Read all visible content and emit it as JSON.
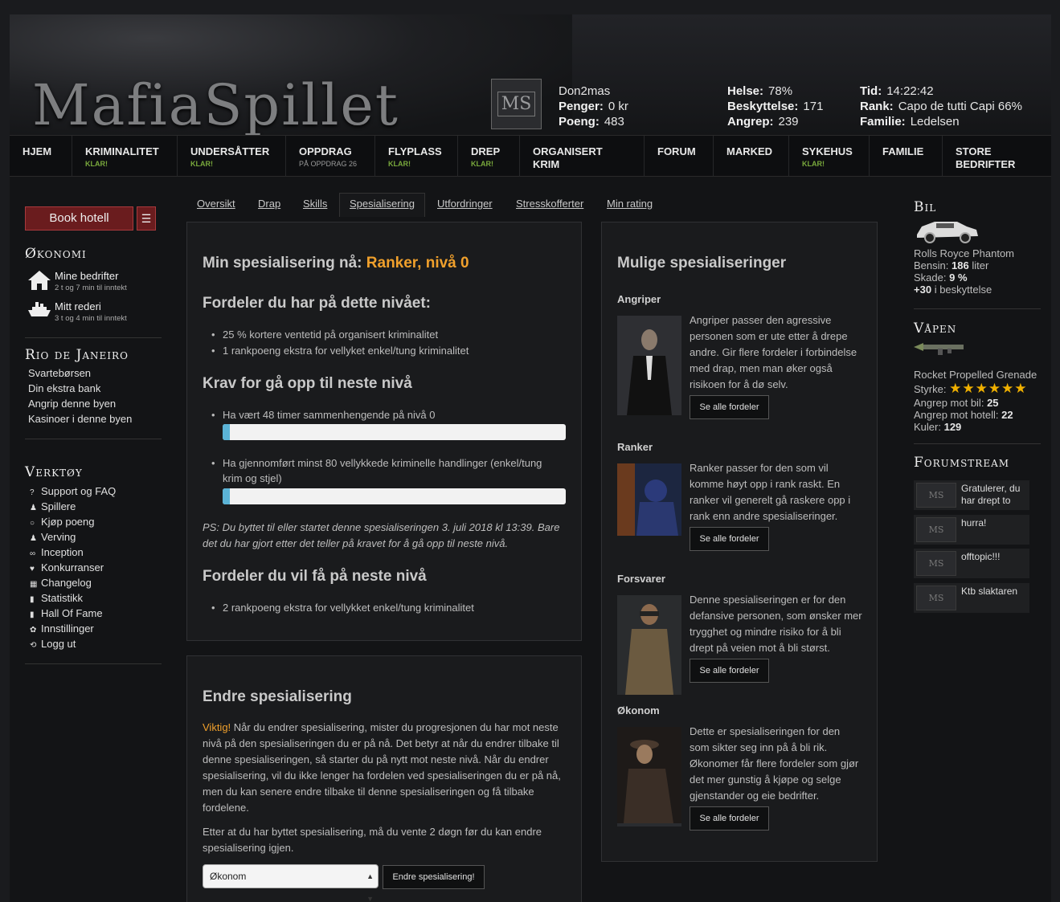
{
  "header": {
    "logo": "MafiaSpillet",
    "avatar": "MS",
    "username": "Don2mas",
    "penger_label": "Penger:",
    "penger": "0 kr",
    "poeng_label": "Poeng:",
    "poeng": "483",
    "helse_label": "Helse:",
    "helse": "78%",
    "beskyttelse_label": "Beskyttelse:",
    "beskyttelse": "171",
    "angrep_label": "Angrep:",
    "angrep": "239",
    "tid_label": "Tid:",
    "tid": "14:22:42",
    "rank_label": "Rank:",
    "rank": "Capo de tutti Capi 66%",
    "familie_label": "Familie:",
    "familie": "Ledelsen"
  },
  "nav": [
    {
      "label": "HJEM",
      "sub": ""
    },
    {
      "label": "KRIMINALITET",
      "sub": "KLAR!"
    },
    {
      "label": "UNDERSÅTTER",
      "sub": "KLAR!"
    },
    {
      "label": "OPPDRAG",
      "sub": "PÅ OPPDRAG 26"
    },
    {
      "label": "FLYPLASS",
      "sub": "KLAR!"
    },
    {
      "label": "DREP",
      "sub": "KLAR!"
    },
    {
      "label": "ORGANISERT KRIM",
      "sub": ""
    },
    {
      "label": "FORUM",
      "sub": ""
    },
    {
      "label": "MARKED",
      "sub": ""
    },
    {
      "label": "SYKEHUS",
      "sub": "KLAR!"
    },
    {
      "label": "FAMILIE",
      "sub": ""
    },
    {
      "label": "STORE BEDRIFTER",
      "sub": ""
    }
  ],
  "sidebar": {
    "book_hotell": "Book hotell",
    "menu_icon": "☰",
    "okonomi_title": "Økonomi",
    "eco_items": [
      {
        "title": "Mine bedrifter",
        "sub": "2 t og 7 min til inntekt",
        "icon": "house-icon"
      },
      {
        "title": "Mitt rederi",
        "sub": "3 t og 4 min til inntekt",
        "icon": "ship-icon"
      }
    ],
    "city_title": "Rio de Janeiro",
    "city_links": [
      "Svartebørsen",
      "Din ekstra bank",
      "Angrip denne byen",
      "Kasinoer i denne byen"
    ],
    "tools_title": "Verktøy",
    "tools": [
      {
        "label": "Support og FAQ",
        "icon": "?"
      },
      {
        "label": "Spillere",
        "icon": "♟"
      },
      {
        "label": "Kjøp poeng",
        "icon": "○"
      },
      {
        "label": "Verving",
        "icon": "♟"
      },
      {
        "label": "Inception",
        "icon": "∞"
      },
      {
        "label": "Konkurranser",
        "icon": "♥"
      },
      {
        "label": "Changelog",
        "icon": "▦"
      },
      {
        "label": "Statistikk",
        "icon": "▮"
      },
      {
        "label": "Hall Of Fame",
        "icon": "▮"
      },
      {
        "label": "Innstillinger",
        "icon": "✿"
      },
      {
        "label": "Logg ut",
        "icon": "⟲"
      }
    ]
  },
  "tabs": [
    "Oversikt",
    "Drap",
    "Skills",
    "Spesialisering",
    "Utfordringer",
    "Stresskofferter",
    "Min rating"
  ],
  "main": {
    "current_prefix": "Min spesialisering nå:",
    "current_value": "Ranker, nivå 0",
    "benefits_title": "Fordeler du har på dette nivået:",
    "benefits": [
      "25 % kortere ventetid på organisert kriminalitet",
      "1 rankpoeng ekstra for vellyket enkel/tung kriminalitet"
    ],
    "req_title": "Krav for gå opp til neste nivå",
    "req1": "Ha vært 48 timer sammenhengende på nivå 0",
    "req1_progress": 0.02,
    "req2_line1": "Ha gjennomført minst 80 vellykkede kriminelle handlinger (enkel/tung",
    "req2_line2": "krim og stjel)",
    "req2_progress": 0.02,
    "ps": "PS: Du byttet til eller startet denne spesialiseringen 3. juli 2018 kl 13:39. Bare det du har gjort etter det teller på kravet for å gå opp til neste nivå.",
    "next_title": "Fordeler du vil få på neste nivå",
    "next_benefits": [
      "2 rankpoeng ekstra for vellykket enkel/tung kriminalitet"
    ]
  },
  "change": {
    "title": "Endre spesialisering",
    "viktig": "Viktig!",
    "text1": " Når du endrer spesialisering, mister du progresjonen du har mot neste nivå på den spesialiseringen du er på nå. Det betyr at når du endrer tilbake til denne spesialiseringen, så starter du på nytt mot neste nivå. Når du endrer spesialisering, vil du ikke lenger ha fordelen ved spesialiseringen du er på nå, men du kan senere endre tilbake til denne spesialiseringen og få tilbake fordelene.",
    "text2": "Etter at du har byttet spesialisering, må du vente 2 døgn før du kan endre spesialisering igjen.",
    "selected": "Økonom",
    "button": "Endre spesialisering!"
  },
  "specs": {
    "title": "Mulige spesialiseringer",
    "button": "Se alle fordeler",
    "items": [
      {
        "name": "Angriper",
        "text": "Angriper passer den agressive personen som er ute etter å drepe andre. Gir flere fordeler i forbindelse med drap, men man øker også risikoen for å dø selv.",
        "color": "#3a3a3e"
      },
      {
        "name": "Ranker",
        "text": "Ranker passer for den som vil komme høyt opp i rank raskt. En ranker vil generelt gå raskere opp i rank enn andre spesialiseringer.",
        "color": "#2b3a6a"
      },
      {
        "name": "Forsvarer",
        "text": "Denne spesialiseringen er for den defansive personen, som ønsker mer trygghet og mindre risiko for å bli drept på veien mot å bli størst.",
        "color": "#5a4a34"
      },
      {
        "name": "Økonom",
        "text": "Dette er spesialiseringen for den som sikter seg inn på å bli rik. Økonomer får flere fordeler som gjør det mer gunstig å kjøpe og selge gjenstander og eie bedrifter.",
        "color": "#3d2f26"
      }
    ]
  },
  "right": {
    "bil_title": "Bil",
    "car_name": "Rolls Royce Phantom",
    "bensin_label": "Bensin:",
    "bensin": "186",
    "bensin_unit": "liter",
    "skade_label": "Skade:",
    "skade": "9 %",
    "beskyttelse": "+30",
    "beskyttelse_text": "i beskyttelse",
    "vapen_title": "Våpen",
    "weapon_name": "Rocket Propelled Grenade",
    "styrke_label": "Styrke:",
    "stars": "★★★★★★",
    "angrep_bil_label": "Angrep mot bil:",
    "angrep_bil": "25",
    "angrep_hotell_label": "Angrep mot hotell:",
    "angrep_hotell": "22",
    "kuler_label": "Kuler:",
    "kuler": "129",
    "forum_title": "Forumstream",
    "forum": [
      "Gratulerer, du har drept to",
      "hurra!",
      "offtopic!!!",
      "Ktb slaktaren"
    ]
  }
}
